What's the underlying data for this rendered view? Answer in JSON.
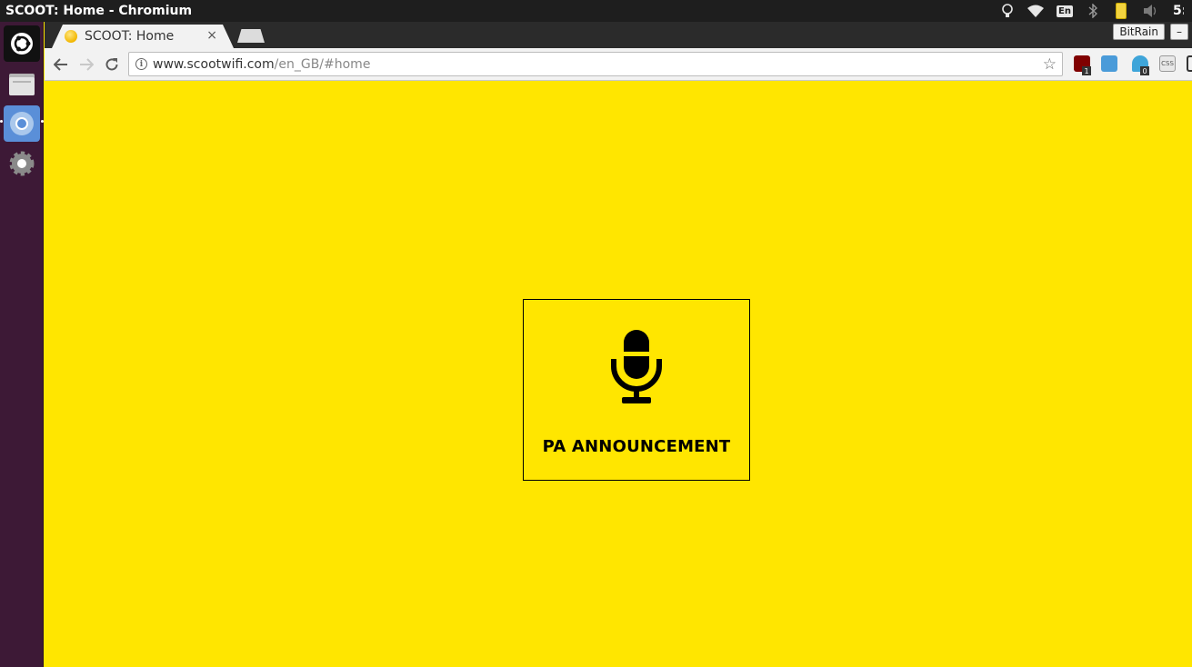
{
  "window": {
    "title": "SCOOT: Home - Chromium"
  },
  "tray": {
    "keyboard_layout": "En",
    "clock": "5:"
  },
  "browser": {
    "tab_title": "SCOOT: Home",
    "tab_close": "×",
    "profile_label": "BitRain",
    "minimize_label": "–",
    "url_host": "www.scootwifi.com",
    "url_path": "/en_GB/#home",
    "extensions": [
      {
        "name": "ublock",
        "badge": "1"
      },
      {
        "name": "skype"
      },
      {
        "name": "ghostery",
        "badge": "0"
      },
      {
        "name": "css-viewer",
        "text": "CSS"
      }
    ]
  },
  "page": {
    "background_color": "#ffe600",
    "card": {
      "icon": "microphone-icon",
      "label": "PA ANNOUNCEMENT"
    }
  }
}
